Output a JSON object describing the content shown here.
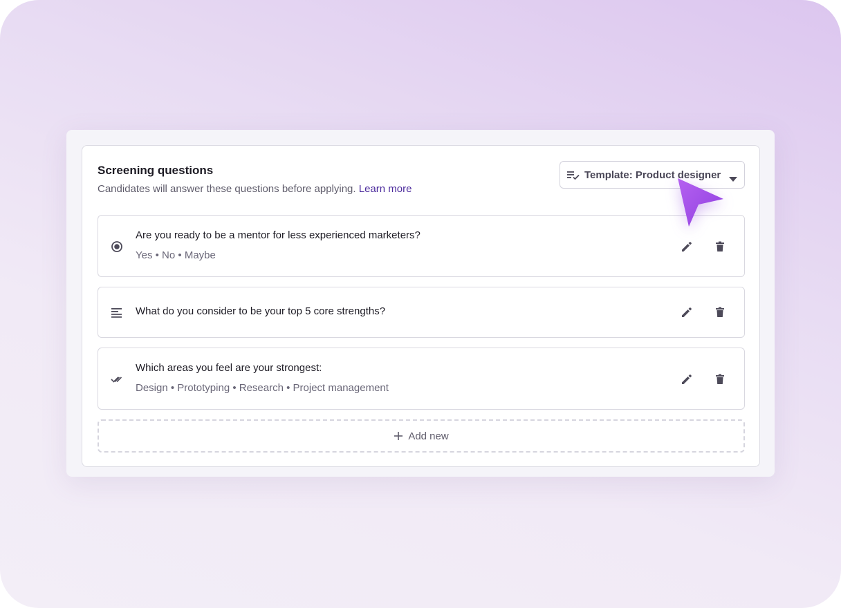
{
  "colors": {
    "accent": "#a64be8",
    "link": "#4b2a9c",
    "text_primary": "#1d1b24",
    "text_secondary": "#5f5c6b",
    "icon": "#4d4a59"
  },
  "section": {
    "title": "Screening questions",
    "subtitle": "Candidates will answer these questions before applying.",
    "learn_more": "Learn more"
  },
  "template_dropdown": {
    "icon": "checklist-icon",
    "label": "Template: Product designer",
    "caret": "caret-down-icon"
  },
  "questions": [
    {
      "type_icon": "radio-icon",
      "text": "Are you ready to be a mentor for less experienced marketers?",
      "options": "Yes • No • Maybe"
    },
    {
      "type_icon": "paragraph-icon",
      "text": "What do you consider to be your top 5 core strengths?"
    },
    {
      "type_icon": "double-check-icon",
      "text": "Which areas you feel are your strongest:",
      "options": "Design • Prototyping • Research • Project management"
    }
  ],
  "add_new": {
    "label": "Add new"
  }
}
